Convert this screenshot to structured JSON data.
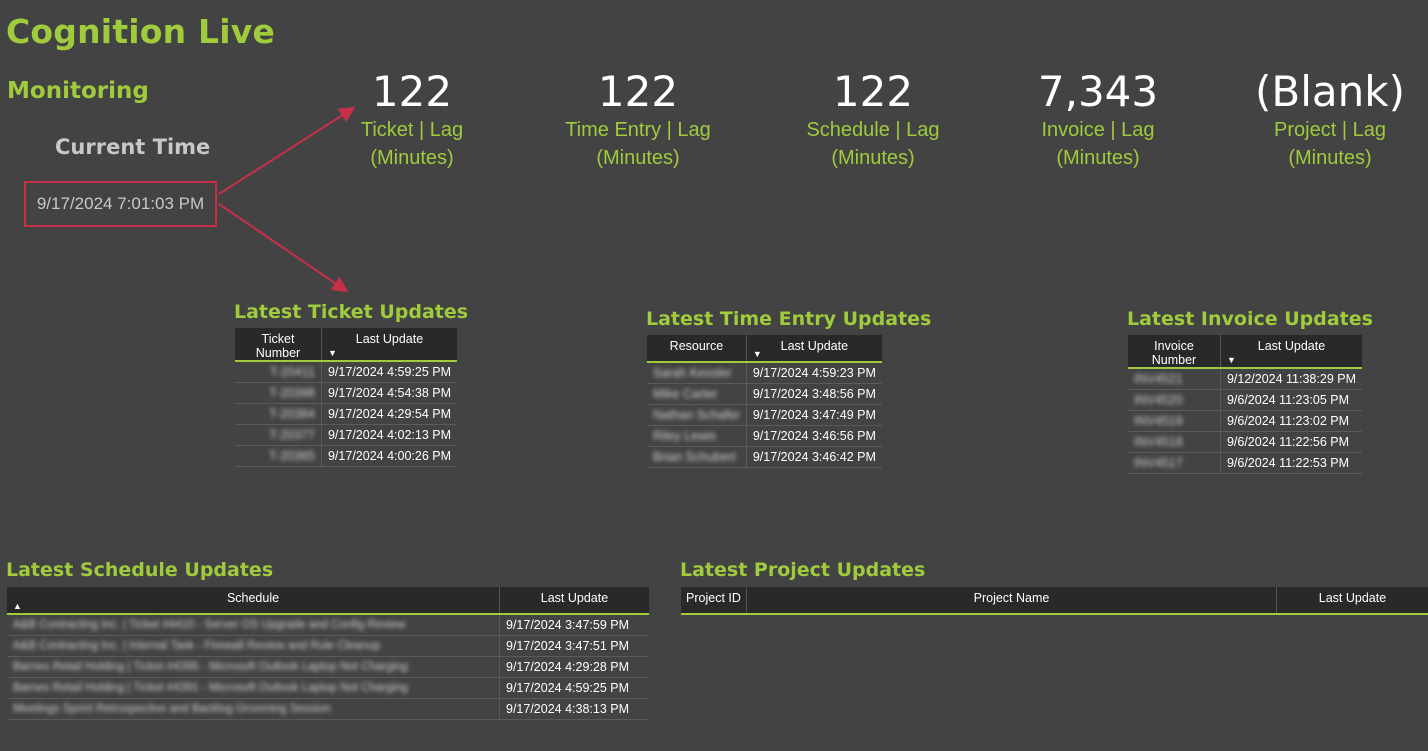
{
  "app": {
    "title": "Cognition Live"
  },
  "section": {
    "title": "Monitoring"
  },
  "current_time": {
    "label": "Current Time",
    "value": "9/17/2024 7:01:03 PM"
  },
  "colors": {
    "accent": "#9fcb3c",
    "background": "#434343",
    "highlight": "#c8304a",
    "header_bg": "#292929"
  },
  "kpis": [
    {
      "value": "122",
      "label_line1": "Ticket | Lag",
      "label_line2": "(Minutes)"
    },
    {
      "value": "122",
      "label_line1": "Time Entry | Lag",
      "label_line2": "(Minutes)"
    },
    {
      "value": "122",
      "label_line1": "Schedule | Lag",
      "label_line2": "(Minutes)"
    },
    {
      "value": "7,343",
      "label_line1": "Invoice | Lag",
      "label_line2": "(Minutes)"
    },
    {
      "value": "(Blank)",
      "label_line1": "Project | Lag",
      "label_line2": "(Minutes)"
    }
  ],
  "tables": {
    "ticket": {
      "title": "Latest Ticket Updates",
      "columns": [
        "Ticket Number",
        "Last Update"
      ],
      "sort_icon": "sort-descending-icon",
      "rows": [
        [
          "T-20411",
          "9/17/2024 4:59:25 PM"
        ],
        [
          "T-20398",
          "9/17/2024 4:54:38 PM"
        ],
        [
          "T-20384",
          "9/17/2024 4:29:54 PM"
        ],
        [
          "T-20377",
          "9/17/2024 4:02:13 PM"
        ],
        [
          "T-20365",
          "9/17/2024 4:00:26 PM"
        ]
      ]
    },
    "time_entry": {
      "title": "Latest Time Entry Updates",
      "columns": [
        "Resource",
        "Last Update"
      ],
      "sort_icon": "sort-descending-icon",
      "rows": [
        [
          "Sarah Kessler",
          "9/17/2024 4:59:23 PM"
        ],
        [
          "Mike Carter",
          "9/17/2024 3:48:56 PM"
        ],
        [
          "Nathan Schafer",
          "9/17/2024 3:47:49 PM"
        ],
        [
          "Riley Lewis",
          "9/17/2024 3:46:56 PM"
        ],
        [
          "Brian Schubert",
          "9/17/2024 3:46:42 PM"
        ]
      ]
    },
    "invoice": {
      "title": "Latest Invoice Updates",
      "columns": [
        "Invoice Number",
        "Last Update"
      ],
      "sort_icon": "sort-descending-icon",
      "rows": [
        [
          "INV4521",
          "9/12/2024 11:38:29 PM"
        ],
        [
          "INV4520",
          "9/6/2024 11:23:05 PM"
        ],
        [
          "INV4519",
          "9/6/2024 11:23:02 PM"
        ],
        [
          "INV4518",
          "9/6/2024 11:22:56 PM"
        ],
        [
          "INV4517",
          "9/6/2024 11:22:53 PM"
        ]
      ]
    },
    "schedule": {
      "title": "Latest Schedule Updates",
      "columns": [
        "Schedule",
        "Last Update"
      ],
      "sort_icon": "sort-ascending-icon",
      "rows": [
        [
          "A&B Contracting Inc. | Ticket #4410 - Server OS Upgrade and Config Review",
          "9/17/2024 3:47:59 PM"
        ],
        [
          "A&B Contracting Inc. | Internal Task - Firewall Review and Rule Cleanup",
          "9/17/2024 3:47:51 PM"
        ],
        [
          "Barnes Retail Holding | Ticket #4395 - Microsoft Outlook Laptop Not Charging",
          "9/17/2024 4:29:28 PM"
        ],
        [
          "Barnes Retail Holding | Ticket #4391 - Microsoft Outlook Laptop Not Charging",
          "9/17/2024 4:59:25 PM"
        ],
        [
          "Meetings Sprint Retrospective and Backlog Grooming Session",
          "9/17/2024 4:38:13 PM"
        ]
      ]
    },
    "project": {
      "title": "Latest Project Updates",
      "columns": [
        "Project ID",
        "Project Name",
        "Last Update"
      ],
      "rows": []
    }
  }
}
